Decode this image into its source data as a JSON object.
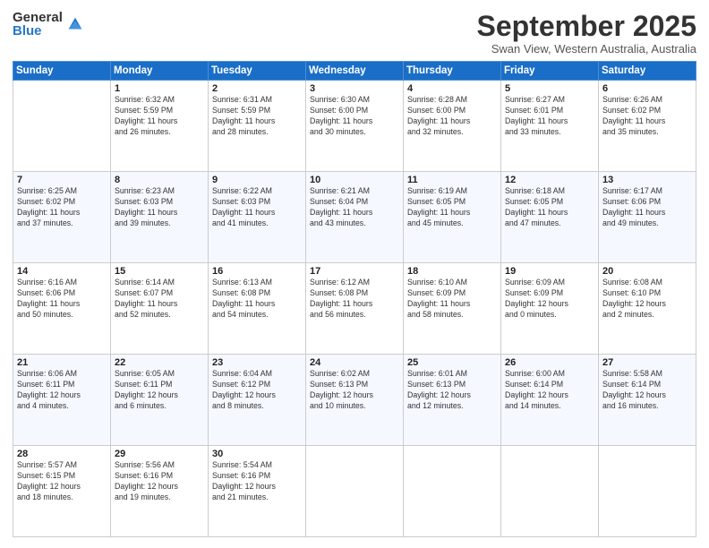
{
  "header": {
    "logo_general": "General",
    "logo_blue": "Blue",
    "month_title": "September 2025",
    "subtitle": "Swan View, Western Australia, Australia"
  },
  "weekdays": [
    "Sunday",
    "Monday",
    "Tuesday",
    "Wednesday",
    "Thursday",
    "Friday",
    "Saturday"
  ],
  "weeks": [
    [
      {
        "day": "",
        "info": ""
      },
      {
        "day": "1",
        "info": "Sunrise: 6:32 AM\nSunset: 5:59 PM\nDaylight: 11 hours\nand 26 minutes."
      },
      {
        "day": "2",
        "info": "Sunrise: 6:31 AM\nSunset: 5:59 PM\nDaylight: 11 hours\nand 28 minutes."
      },
      {
        "day": "3",
        "info": "Sunrise: 6:30 AM\nSunset: 6:00 PM\nDaylight: 11 hours\nand 30 minutes."
      },
      {
        "day": "4",
        "info": "Sunrise: 6:28 AM\nSunset: 6:00 PM\nDaylight: 11 hours\nand 32 minutes."
      },
      {
        "day": "5",
        "info": "Sunrise: 6:27 AM\nSunset: 6:01 PM\nDaylight: 11 hours\nand 33 minutes."
      },
      {
        "day": "6",
        "info": "Sunrise: 6:26 AM\nSunset: 6:02 PM\nDaylight: 11 hours\nand 35 minutes."
      }
    ],
    [
      {
        "day": "7",
        "info": "Sunrise: 6:25 AM\nSunset: 6:02 PM\nDaylight: 11 hours\nand 37 minutes."
      },
      {
        "day": "8",
        "info": "Sunrise: 6:23 AM\nSunset: 6:03 PM\nDaylight: 11 hours\nand 39 minutes."
      },
      {
        "day": "9",
        "info": "Sunrise: 6:22 AM\nSunset: 6:03 PM\nDaylight: 11 hours\nand 41 minutes."
      },
      {
        "day": "10",
        "info": "Sunrise: 6:21 AM\nSunset: 6:04 PM\nDaylight: 11 hours\nand 43 minutes."
      },
      {
        "day": "11",
        "info": "Sunrise: 6:19 AM\nSunset: 6:05 PM\nDaylight: 11 hours\nand 45 minutes."
      },
      {
        "day": "12",
        "info": "Sunrise: 6:18 AM\nSunset: 6:05 PM\nDaylight: 11 hours\nand 47 minutes."
      },
      {
        "day": "13",
        "info": "Sunrise: 6:17 AM\nSunset: 6:06 PM\nDaylight: 11 hours\nand 49 minutes."
      }
    ],
    [
      {
        "day": "14",
        "info": "Sunrise: 6:16 AM\nSunset: 6:06 PM\nDaylight: 11 hours\nand 50 minutes."
      },
      {
        "day": "15",
        "info": "Sunrise: 6:14 AM\nSunset: 6:07 PM\nDaylight: 11 hours\nand 52 minutes."
      },
      {
        "day": "16",
        "info": "Sunrise: 6:13 AM\nSunset: 6:08 PM\nDaylight: 11 hours\nand 54 minutes."
      },
      {
        "day": "17",
        "info": "Sunrise: 6:12 AM\nSunset: 6:08 PM\nDaylight: 11 hours\nand 56 minutes."
      },
      {
        "day": "18",
        "info": "Sunrise: 6:10 AM\nSunset: 6:09 PM\nDaylight: 11 hours\nand 58 minutes."
      },
      {
        "day": "19",
        "info": "Sunrise: 6:09 AM\nSunset: 6:09 PM\nDaylight: 12 hours\nand 0 minutes."
      },
      {
        "day": "20",
        "info": "Sunrise: 6:08 AM\nSunset: 6:10 PM\nDaylight: 12 hours\nand 2 minutes."
      }
    ],
    [
      {
        "day": "21",
        "info": "Sunrise: 6:06 AM\nSunset: 6:11 PM\nDaylight: 12 hours\nand 4 minutes."
      },
      {
        "day": "22",
        "info": "Sunrise: 6:05 AM\nSunset: 6:11 PM\nDaylight: 12 hours\nand 6 minutes."
      },
      {
        "day": "23",
        "info": "Sunrise: 6:04 AM\nSunset: 6:12 PM\nDaylight: 12 hours\nand 8 minutes."
      },
      {
        "day": "24",
        "info": "Sunrise: 6:02 AM\nSunset: 6:13 PM\nDaylight: 12 hours\nand 10 minutes."
      },
      {
        "day": "25",
        "info": "Sunrise: 6:01 AM\nSunset: 6:13 PM\nDaylight: 12 hours\nand 12 minutes."
      },
      {
        "day": "26",
        "info": "Sunrise: 6:00 AM\nSunset: 6:14 PM\nDaylight: 12 hours\nand 14 minutes."
      },
      {
        "day": "27",
        "info": "Sunrise: 5:58 AM\nSunset: 6:14 PM\nDaylight: 12 hours\nand 16 minutes."
      }
    ],
    [
      {
        "day": "28",
        "info": "Sunrise: 5:57 AM\nSunset: 6:15 PM\nDaylight: 12 hours\nand 18 minutes."
      },
      {
        "day": "29",
        "info": "Sunrise: 5:56 AM\nSunset: 6:16 PM\nDaylight: 12 hours\nand 19 minutes."
      },
      {
        "day": "30",
        "info": "Sunrise: 5:54 AM\nSunset: 6:16 PM\nDaylight: 12 hours\nand 21 minutes."
      },
      {
        "day": "",
        "info": ""
      },
      {
        "day": "",
        "info": ""
      },
      {
        "day": "",
        "info": ""
      },
      {
        "day": "",
        "info": ""
      }
    ]
  ]
}
